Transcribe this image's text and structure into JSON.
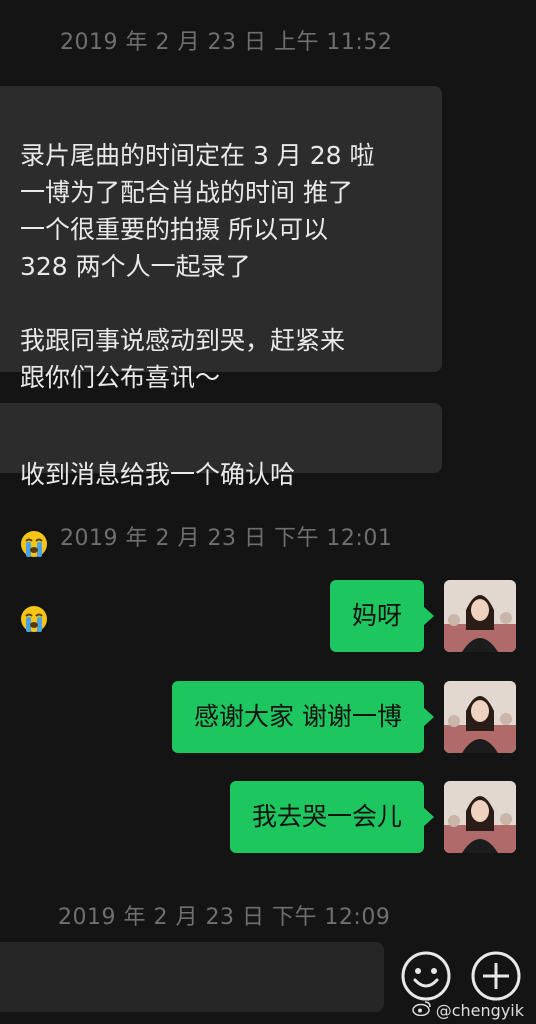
{
  "timestamps": [
    "2019 年 2 月 23 日  上午 11:52",
    "2019 年 2 月 23 日  下午 12:01",
    "2019 年 2 月 23 日  下午 12:09"
  ],
  "incoming": [
    {
      "text": "录片尾曲的时间定在 3 月 28 啦\n一博为了配合肖战的时间 推了\n一个很重要的拍摄 所以可以\n328 两个人一起录了\n\n我跟同事说感动到哭，赶紧来\n跟你们公布喜讯～"
    },
    {
      "text": "收到消息给我一个确认哈",
      "emoji": [
        "crying-face-emoji",
        "crying-face-emoji"
      ]
    }
  ],
  "outgoing": [
    {
      "text": "妈呀"
    },
    {
      "text": "感谢大家 谢谢一博"
    },
    {
      "text": "我去哭一会儿"
    }
  ],
  "toolbar": {
    "emoji_icon": "smiley-icon",
    "more_icon": "plus-circle-icon"
  },
  "watermark": {
    "text": "@chengyik",
    "icon": "weibo-logo-icon"
  },
  "colors": {
    "background": "#141414",
    "incoming_bubble": "#2c2c2c",
    "outgoing_bubble": "#1ec660",
    "timestamp": "#6f6f6f"
  }
}
